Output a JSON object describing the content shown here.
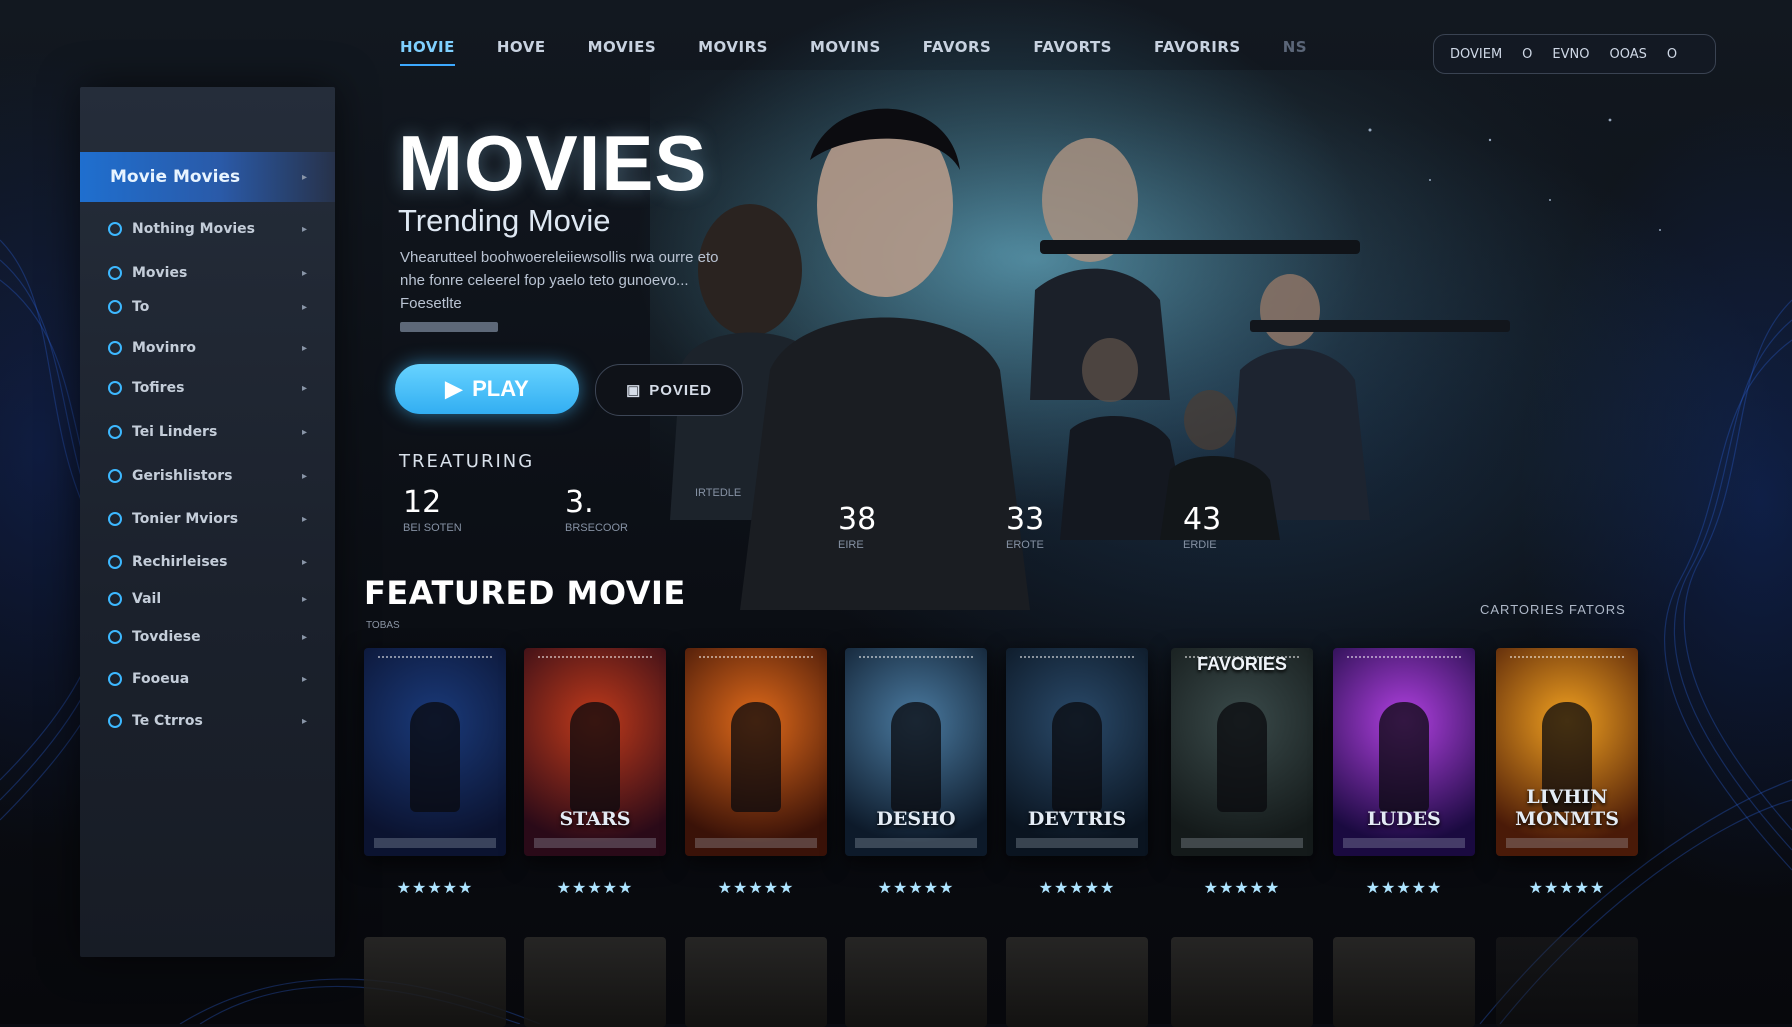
{
  "nav": {
    "items": [
      "HOVIE",
      "HOVE",
      "MOVIES",
      "MOVIRS",
      "MOVINS",
      "FAVORS",
      "FAVORTS",
      "FAVORIRS",
      "NS"
    ],
    "active_index": 0
  },
  "top_right": {
    "items": [
      "DOVIEM",
      "O",
      "EVNO",
      "OOAS",
      "O"
    ]
  },
  "sidebar": {
    "items": [
      {
        "label": "Movie Movies",
        "active": true
      },
      {
        "label": "Nothing Movies"
      },
      {
        "label": "Movies"
      },
      {
        "label": "To"
      },
      {
        "label": "Movinro"
      },
      {
        "label": "Tofires"
      },
      {
        "label": "Tei Linders"
      },
      {
        "label": "Gerishlistors"
      },
      {
        "label": "Tonier Mviors"
      },
      {
        "label": "Rechirleises"
      },
      {
        "label": "Vail"
      },
      {
        "label": "Tovdiese"
      },
      {
        "label": "Fooeua"
      },
      {
        "label": "Te Ctrros"
      }
    ]
  },
  "hero": {
    "title": "MOVIES",
    "subtitle": "Trending Movie",
    "description": "Vhearutteel boohwoereleiiewsollis rwa ourre eto nhe fonre celeerel fop yaelo teto gunoevo... Foesetlte",
    "play_label": "PLAY",
    "preview_label": "POVIED",
    "featuring_label": "TREATURING",
    "stats": [
      {
        "value": "12",
        "label": "BEI SOTEN"
      },
      {
        "value": "3.",
        "label": "BRSECOOR"
      },
      {
        "value": "",
        "label": "IRTEDLE"
      },
      {
        "value": "38",
        "label": "EIRE"
      },
      {
        "value": "33",
        "label": "EROTE"
      },
      {
        "value": "43",
        "label": "ERDIE"
      }
    ]
  },
  "featured": {
    "title": "FEATURED MOVIE",
    "subtitle": "TOBAS",
    "right_link": "CARTORIES FATORS",
    "cards": [
      {
        "title": "",
        "top": "",
        "colors": [
          "#1a3a7a",
          "#0b1330"
        ],
        "stars": "★★★★★",
        "rating": 5
      },
      {
        "title": "STARS",
        "top": "",
        "colors": [
          "#c03a1a",
          "#2a0a18"
        ],
        "stars": "★★★★★",
        "rating": 5
      },
      {
        "title": "",
        "top": "",
        "colors": [
          "#e06a1a",
          "#3a1208"
        ],
        "stars": "★★★★★",
        "rating": 5
      },
      {
        "title": "DESHO",
        "top": "",
        "colors": [
          "#4a7aa0",
          "#0d1a2a"
        ],
        "stars": "★★★★★",
        "rating": 5
      },
      {
        "title": "DEVTRIS",
        "top": "",
        "colors": [
          "#2a4a6a",
          "#0a1420"
        ],
        "stars": "★★★★★",
        "rating": 5
      },
      {
        "title": "",
        "top": "FAVORIES",
        "colors": [
          "#3a4a4a",
          "#141a1a"
        ],
        "stars": "★★★★★",
        "rating": 5
      },
      {
        "title": "LUDES",
        "top": "",
        "colors": [
          "#b040e0",
          "#1a0a40"
        ],
        "stars": "★★★★★",
        "rating": 5
      },
      {
        "title": "LIVHIN MONMTS",
        "top": "",
        "colors": [
          "#f0a020",
          "#4a1a08"
        ],
        "stars": "★★★★★",
        "rating": 5
      }
    ]
  },
  "colors": {
    "accent": "#3da9ff",
    "play": "#44b8f5",
    "sidebar_active": "#1f6fcf"
  },
  "icons": {
    "play": "play-icon",
    "preview": "film-icon",
    "chevron": "chevron-right-icon",
    "sidebar": "circle-icon"
  }
}
